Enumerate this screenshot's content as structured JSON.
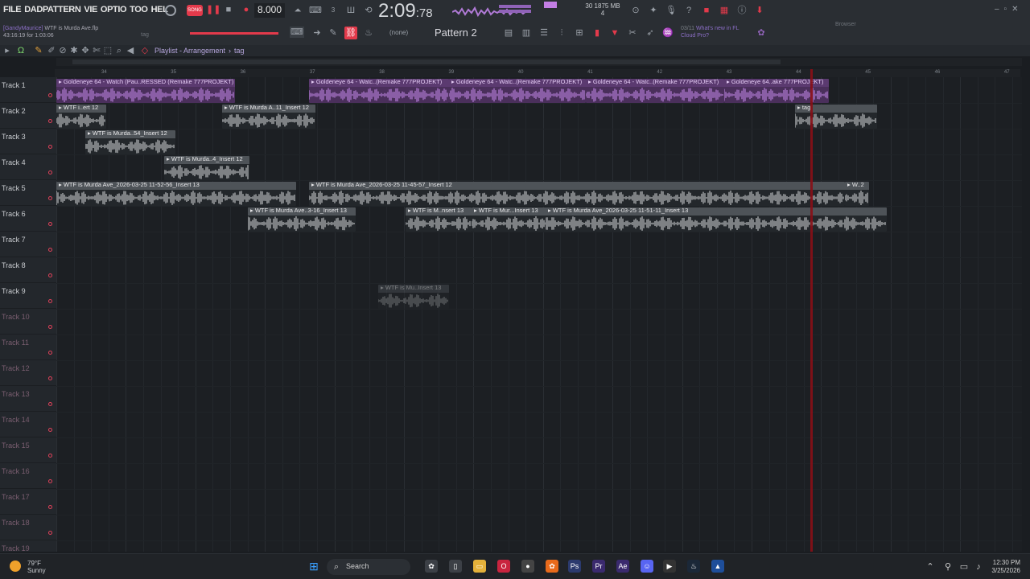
{
  "menu": [
    "FILE",
    "DADPATTERN",
    "VIE",
    "OPTIO",
    "TOO",
    "HEL"
  ],
  "song": {
    "user": "[GandyMaurice]",
    "file": "WTF is Murda Ave.flp",
    "session": "43:16:19 for 1:03:06"
  },
  "transport": {
    "tempo": "8.000",
    "time_main": "2:09",
    "time_sub": ":78",
    "status_cpu": "30",
    "status_mem": "1875 MB",
    "status_voices": "4"
  },
  "toolbar": {
    "pattern": "Pattern 2",
    "none": "(none)",
    "tag": "tag",
    "news_date": "03/11",
    "news_text": "What's new in FL",
    "news_text2": "Cloud Pro?",
    "browser": "Browser"
  },
  "playlist": {
    "title": "Playlist - Arrangement",
    "tag": "tag"
  },
  "ruler": [
    "34",
    "35",
    "36",
    "37",
    "38",
    "39",
    "40",
    "41",
    "42",
    "43",
    "44",
    "45",
    "46",
    "47"
  ],
  "tracks": [
    "Track 1",
    "Track 2",
    "Track 3",
    "Track 4",
    "Track 5",
    "Track 6",
    "Track 7",
    "Track 8",
    "Track 9",
    "Track 10",
    "Track 11",
    "Track 12",
    "Track 13",
    "Track 14",
    "Track 15",
    "Track 16",
    "Track 17",
    "Track 18",
    "Track 19"
  ],
  "clips": [
    {
      "track": 1,
      "kind": "purple",
      "label": "Goldeneye 64 - Watch (Pau..RESSED (Remake 777PROJEKT)"
    },
    {
      "track": 1,
      "kind": "purple",
      "label": "Goldeneye 64 - Watc..(Remake 777PROJEKT)"
    },
    {
      "track": 1,
      "kind": "purple",
      "label": "Goldeneye 64 - Watc..(Remake 777PROJEKT)"
    },
    {
      "track": 1,
      "kind": "purple",
      "label": "Goldeneye 64 - Watc..(Remake 777PROJEKT)"
    },
    {
      "track": 1,
      "kind": "purple",
      "label": "Goldeneye 64..ake 777PROJEKT)"
    },
    {
      "track": 2,
      "kind": "gray",
      "label": "WTF i..ert 12"
    },
    {
      "track": 2,
      "kind": "gray",
      "label": "WTF is Murda A..11_Insert 12"
    },
    {
      "track": 2,
      "kind": "gray",
      "label": "tag"
    },
    {
      "track": 3,
      "kind": "gray",
      "label": "WTF is Murda..54_Insert 12"
    },
    {
      "track": 4,
      "kind": "gray",
      "label": "WTF is Murda..4_Insert 12"
    },
    {
      "track": 5,
      "kind": "gray",
      "label": "WTF is Murda Ave_2026-03-25 11-52-56_Insert 13"
    },
    {
      "track": 5,
      "kind": "gray",
      "label": "WTF is Murda Ave_2026-03-25 11-45-57_Insert 12"
    },
    {
      "track": 5,
      "kind": "gray",
      "label": "W..2"
    },
    {
      "track": 6,
      "kind": "gray",
      "label": "WTF is Murda Ave..3-16_Insert 13"
    },
    {
      "track": 6,
      "kind": "gray",
      "label": "WTF is M..nsert 13"
    },
    {
      "track": 6,
      "kind": "gray",
      "label": "WTF is Mur...Insert 13"
    },
    {
      "track": 6,
      "kind": "gray",
      "label": "WTF is Murda Ave_2026-03-25 11-51-11_Insert 13"
    },
    {
      "track": 9,
      "kind": "gray",
      "label": "WTF is Mu..Insert 13"
    }
  ],
  "taskbar": {
    "temp": "79°F",
    "cond": "Sunny",
    "search": "Search",
    "time": "12:30 PM",
    "date": "3/25/2026"
  },
  "colors": {
    "accent": "#e33a4b",
    "purple": "#5b3a70",
    "playhead": "#8a0e16"
  }
}
